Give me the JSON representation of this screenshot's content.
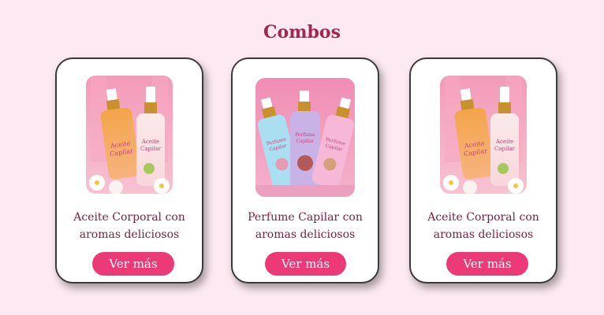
{
  "section": {
    "title": "Combos"
  },
  "cards": [
    {
      "caption_line1": "Aceite Corporal con",
      "caption_line2": "aromas deliciosos",
      "button_label": "Ver más",
      "image_alt": "Aceite Capilar"
    },
    {
      "caption_line1": "Perfume Capilar con",
      "caption_line2": "aromas deliciosos",
      "button_label": "Ver más",
      "image_alt": "Perfume Capilar"
    },
    {
      "caption_line1": "Aceite Corporal con",
      "caption_line2": "aromas deliciosos",
      "button_label": "Ver más",
      "image_alt": "Aceite Capilar"
    }
  ],
  "colors": {
    "page_background": "#fde9f1",
    "title": "#a3264f",
    "caption": "#7a2044",
    "button": "#ec3a77",
    "card_border": "#3a3a3a"
  }
}
